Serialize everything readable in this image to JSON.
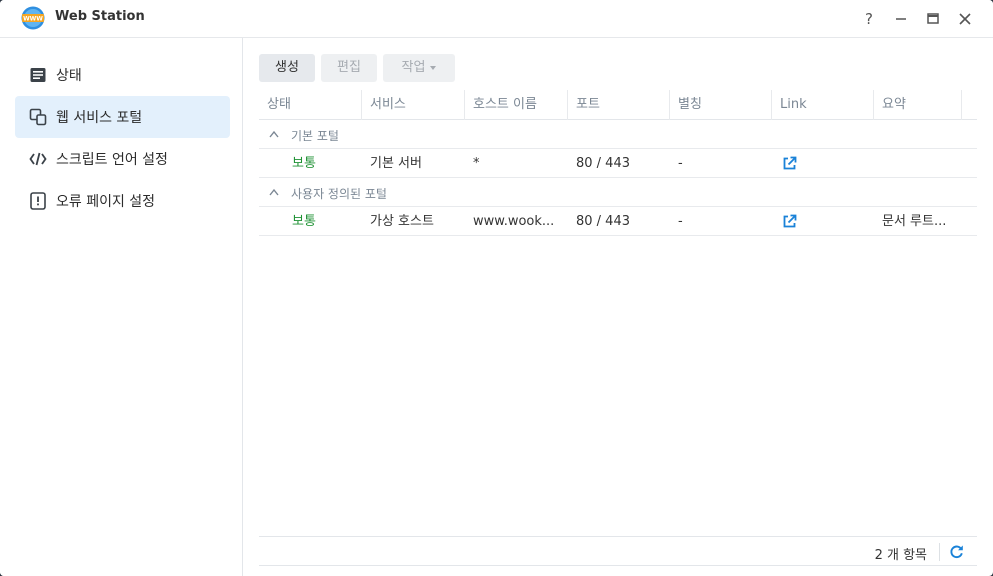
{
  "window": {
    "title": "Web Station",
    "logo_text": "WWW",
    "controls": {
      "help": "?",
      "minimize": "—",
      "maximize": "□",
      "close": "✕"
    }
  },
  "sidebar": {
    "items": [
      {
        "label": "상태",
        "icon": "status-icon",
        "active": false
      },
      {
        "label": "웹 서비스 포털",
        "icon": "portal-icon",
        "active": true
      },
      {
        "label": "스크립트 언어 설정",
        "icon": "code-icon",
        "active": false
      },
      {
        "label": "오류 페이지 설정",
        "icon": "error-page-icon",
        "active": false
      }
    ]
  },
  "toolbar": {
    "create_label": "생성",
    "edit_label": "편집",
    "action_label": "작업"
  },
  "table": {
    "columns": [
      "상태",
      "서비스",
      "호스트 이름",
      "포트",
      "별칭",
      "Link",
      "요약"
    ],
    "groups": [
      {
        "label": "기본 포털",
        "rows": [
          {
            "status": "보통",
            "service": "기본 서버",
            "host": "*",
            "port": "80 / 443",
            "alias": "-",
            "summary": ""
          }
        ]
      },
      {
        "label": "사용자 정의된 포털",
        "rows": [
          {
            "status": "보통",
            "service": "가상 호스트",
            "host": "www.wook...",
            "port": "80 / 443",
            "alias": "-",
            "summary": "문서 루트..."
          }
        ]
      }
    ]
  },
  "footer": {
    "count_text": "2 개 항목"
  },
  "colors": {
    "accent": "#1a82d8",
    "status_ok": "#1f9234",
    "active_bg": "#e3f0fc"
  }
}
